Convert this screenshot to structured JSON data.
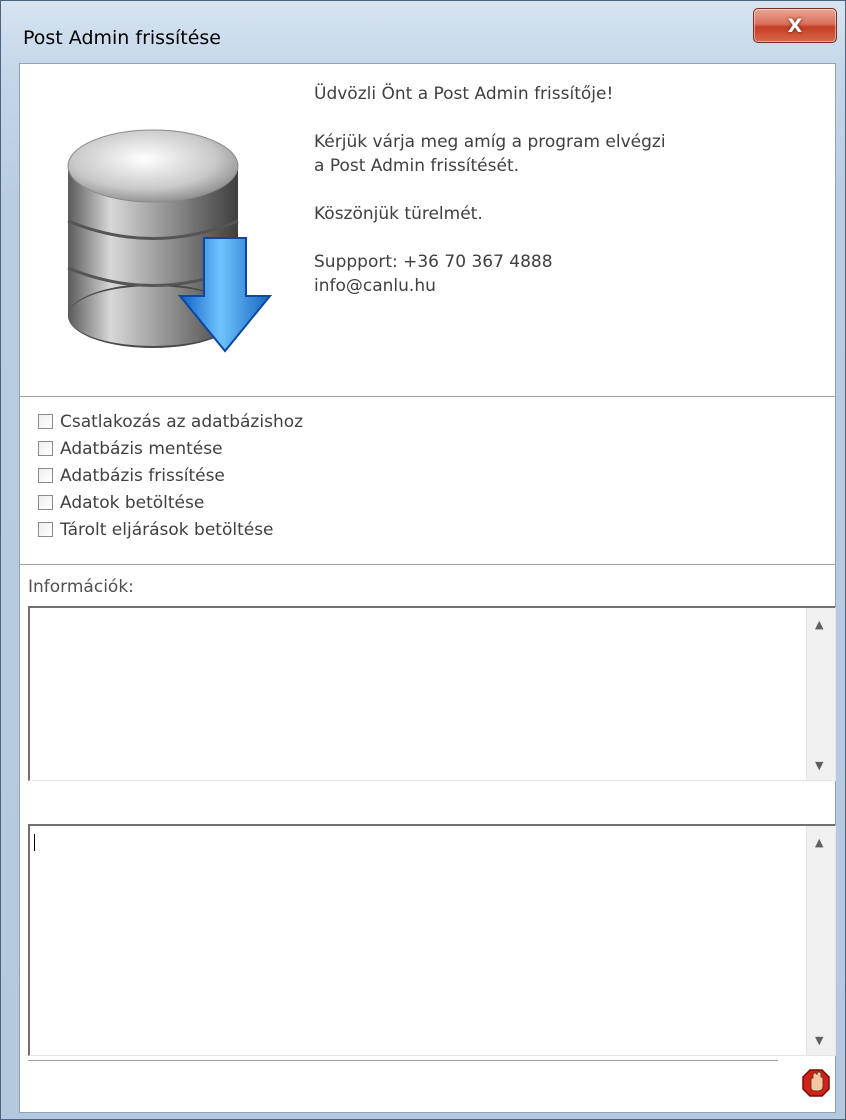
{
  "window": {
    "title": "Post Admin frissítése",
    "close_label": "X"
  },
  "banner": {
    "icon": "database-download-icon",
    "welcome": "Üdvözli Önt a Post Admin frissítője!\n\nKérjük várja meg amíg a program elvégzi\na Post Admin frissítését.\n\nKöszönjük türelmét.\n\nSuppport: +36 70 367 4888\ninfo@canlu.hu"
  },
  "steps": [
    {
      "label": "Csatlakozás az adatbázishoz",
      "checked": false
    },
    {
      "label": "Adatbázis mentése",
      "checked": false
    },
    {
      "label": "Adatbázis frissítése",
      "checked": false
    },
    {
      "label": "Adatok betöltése",
      "checked": false
    },
    {
      "label": "Tárolt eljárások betöltése",
      "checked": false
    }
  ],
  "info": {
    "label": "Információk:",
    "info_text": "",
    "log_text": ""
  },
  "status": {
    "icon": "stop-hand-icon"
  },
  "colors": {
    "close_button": "#c43d25",
    "arrow_blue": "#1e88e5"
  }
}
